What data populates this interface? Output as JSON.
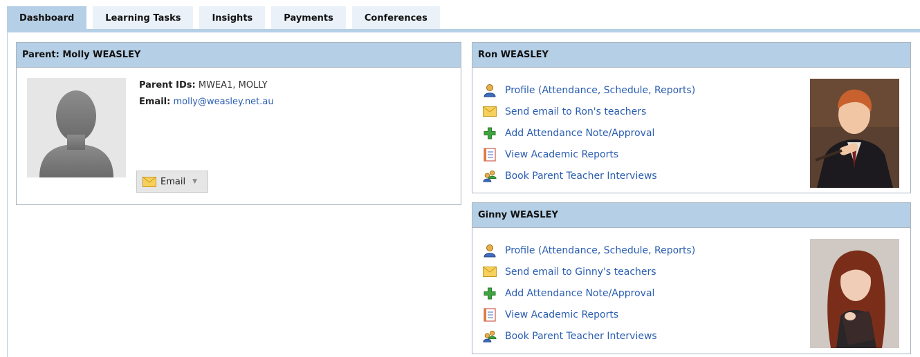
{
  "tabs": [
    {
      "label": "Dashboard",
      "active": true
    },
    {
      "label": "Learning Tasks",
      "active": false
    },
    {
      "label": "Insights",
      "active": false
    },
    {
      "label": "Payments",
      "active": false
    },
    {
      "label": "Conferences",
      "active": false
    }
  ],
  "parent": {
    "title": "Parent: Molly WEASLEY",
    "ids_label": "Parent IDs:",
    "ids_value": "MWEA1, MOLLY",
    "email_label": "Email:",
    "email_value": "molly@weasley.net.au",
    "email_button": "Email"
  },
  "students": [
    {
      "title": "Ron WEASLEY",
      "links": [
        {
          "label": "Profile (Attendance, Schedule, Reports)",
          "icon": "person-icon"
        },
        {
          "label": "Send email to Ron's teachers",
          "icon": "envelope-icon"
        },
        {
          "label": "Add Attendance Note/Approval",
          "icon": "plus-icon"
        },
        {
          "label": "View Academic Reports",
          "icon": "report-icon"
        },
        {
          "label": "Book Parent Teacher Interviews",
          "icon": "interview-icon"
        }
      ]
    },
    {
      "title": "Ginny WEASLEY",
      "links": [
        {
          "label": "Profile (Attendance, Schedule, Reports)",
          "icon": "person-icon"
        },
        {
          "label": "Send email to Ginny's teachers",
          "icon": "envelope-icon"
        },
        {
          "label": "Add Attendance Note/Approval",
          "icon": "plus-icon"
        },
        {
          "label": "View Academic Reports",
          "icon": "report-icon"
        },
        {
          "label": "Book Parent Teacher Interviews",
          "icon": "interview-icon"
        }
      ]
    }
  ],
  "colors": {
    "tab_active": "#b5cfe6",
    "tab_inactive": "#eaf1f8",
    "link": "#2a5db0",
    "panel_header": "#b5cfe6"
  }
}
